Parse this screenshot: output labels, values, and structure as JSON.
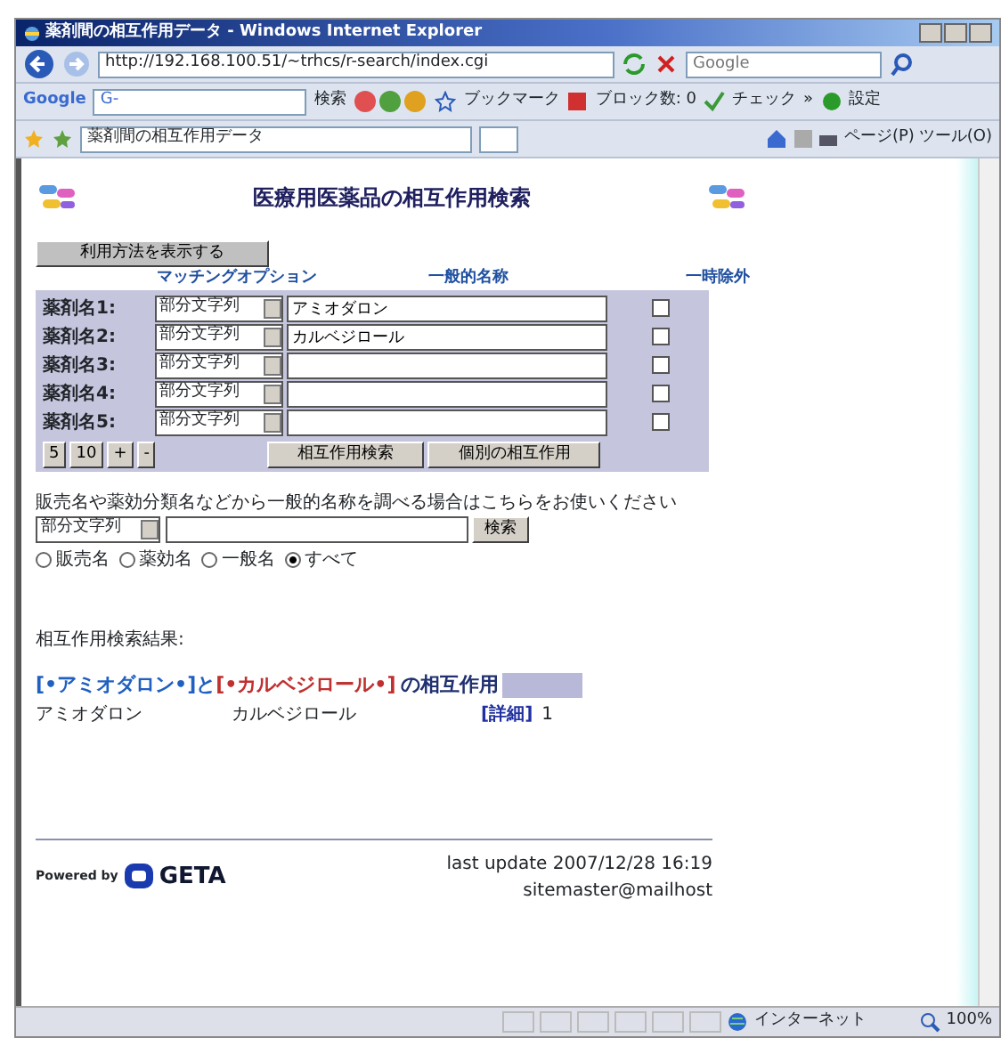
{
  "window": {
    "title": "薬剤間の相互作用データ - Windows Internet Explorer"
  },
  "address_bar": {
    "url": "http://192.168.100.51/~trhcs/r-search/index.cgi"
  },
  "search_box": {
    "placeholder": "Google"
  },
  "google_toolbar": {
    "logo": "Google",
    "field": "G-",
    "search_label": "検索",
    "items": [
      "ブックマーク",
      "ブロック数: 0",
      "チェック",
      "»",
      "設定"
    ]
  },
  "tab": {
    "title": "薬剤間の相互作用データ"
  },
  "command_bar": [
    "ページ(P)",
    "ツール(O)"
  ],
  "page": {
    "heading": "医療用医薬品の相互作用検索",
    "usage_button": "利用方法を表示する",
    "columns": [
      "マッチングオプション",
      "一般的名称",
      "一時除外"
    ],
    "rows": [
      {
        "label": "薬剤名1:",
        "option": "部分文字列",
        "value": "アミオダロン",
        "excluded": false
      },
      {
        "label": "薬剤名2:",
        "option": "部分文字列",
        "value": "カルベジロール",
        "excluded": false
      },
      {
        "label": "薬剤名3:",
        "option": "部分文字列",
        "excluded": false
      },
      {
        "label": "薬剤名4:",
        "option": "部分文字列",
        "excluded": false
      },
      {
        "label": "薬剤名5:",
        "option": "部分文字列",
        "excluded": false
      }
    ],
    "count_buttons": [
      "5",
      "10",
      "+",
      "-"
    ],
    "action_buttons": [
      "相互作用検索",
      "個別の相互作用"
    ],
    "lookup": {
      "hint": "販売名や薬効分類名などから一般的名称を調べる場合はこちらをお使いください",
      "option": "部分文字列",
      "button": "検索",
      "radios": [
        {
          "label": "販売名",
          "selected": false
        },
        {
          "label": "薬効名",
          "selected": false
        },
        {
          "label": "一般名",
          "selected": false
        },
        {
          "label": "すべて",
          "selected": true
        }
      ]
    },
    "results_title": "相互作用検索結果:",
    "result_heading": {
      "drug_a": "[•アミオダロン•]",
      "joiner": "と",
      "drug_b": "[•カルベジロール•]",
      "suffix": "の相互作用"
    },
    "result_rows": [
      {
        "drug_a": "アミオダロン",
        "drug_b": "カルベジロール",
        "link": "[詳細]",
        "count": "1"
      }
    ],
    "footer": {
      "powered_by": "Powered by",
      "logo": "GETA",
      "last_update": "last update 2007/12/28 16:19",
      "email": "sitemaster@mailhost"
    }
  },
  "status_bar": {
    "zone": "インターネット",
    "zoom": "100%"
  }
}
